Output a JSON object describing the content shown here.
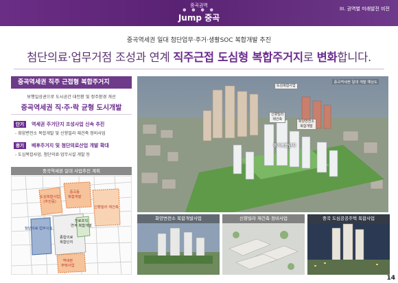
{
  "header": {
    "region": "중곡권역",
    "title": "Jump 중곡",
    "section": "III. 권역별 미래발전 비전",
    "dots": "● ● ● ●"
  },
  "subtitle": "중곡역세권 일대 첨단업무·주거·생활SOC 복합개발 추진",
  "main_title": {
    "prefix": "첨단의료·업무거점 조성과 연계 ",
    "highlight": "직주근접 도심형 복합주거지",
    "suffix": "로 ",
    "highlight2": "변화",
    "end": "합니다."
  },
  "left": {
    "box_title": "중곡역세권 직주 근접형 복합주거지",
    "sub1": "보행일상권으로 도시공간 대전환 및 정주환경 개선",
    "sub2": "중곡역세권 직·주·락 균형 도시개발",
    "phases": [
      {
        "tag": "단기",
        "task": "역세권 주거단지 조성사업 신속 추진",
        "detail": "- 화양변전소 복합개발 및 신향빌라 재건축 정비사업"
      },
      {
        "tag": "중기",
        "task": "배후주거지 및 첨단의료산업 개발 확대",
        "detail": "- 도심복합사업, 첨단의료·업무시설 개발 등"
      }
    ]
  },
  "map": {
    "title": "중곡역세권 일대 사업추진 계획",
    "labels": {
      "a": "도심복합사업\n(추진중)",
      "b": "중곡동\n복합개발",
      "c": "신향빌라 재건축",
      "d": "진료조직\n연계 복합개발",
      "e": "첨단의료·업무시설",
      "f": "종합의료\n복합단지",
      "g": "역세권\n주택사업"
    }
  },
  "aerial": {
    "caption": "중곡역세권 일대 개발 예상도",
    "callouts": {
      "a": "도심복합사업",
      "b": "신향빌라\n재건축",
      "c": "화양변전소\n복합개발",
      "d": "주거복합단지"
    }
  },
  "thumbs": [
    {
      "caption": "화양변전소 복합개발사업"
    },
    {
      "caption": "신향빌라 재건축 정비사업"
    },
    {
      "caption": "중곡 도심공공주택 복합사업"
    }
  ],
  "page_number": "14",
  "colors": {
    "brand": "#6b2c8e",
    "header": "#5a2273",
    "accent_orange": "#f0a66d",
    "accent_blue": "#4a6fa5"
  }
}
